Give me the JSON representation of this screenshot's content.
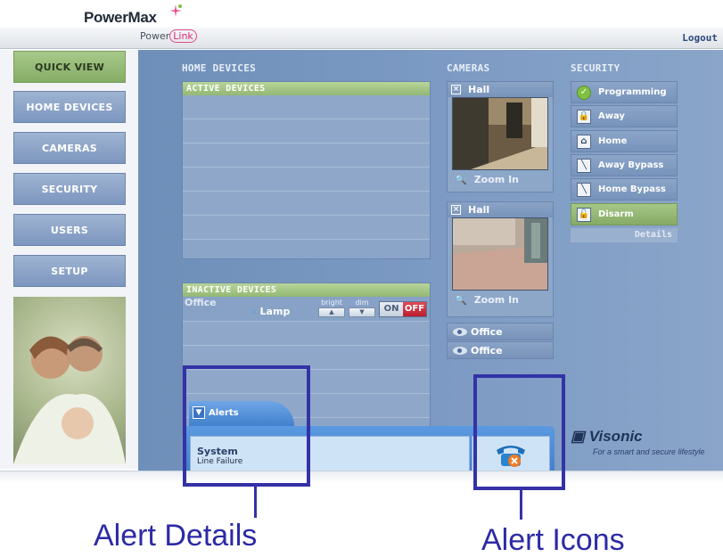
{
  "header": {
    "brand": "PowerMax",
    "sub_brand_prefix": "Power",
    "sub_brand_link": "Link",
    "logout": "Logout"
  },
  "sidebar": {
    "items": [
      {
        "label": "QUICK VIEW",
        "active": true
      },
      {
        "label": "HOME DEVICES",
        "active": false
      },
      {
        "label": "CAMERAS",
        "active": false
      },
      {
        "label": "SECURITY",
        "active": false
      },
      {
        "label": "USERS",
        "active": false
      },
      {
        "label": "SETUP",
        "active": false
      }
    ]
  },
  "home_devices": {
    "title": "HOME DEVICES",
    "active_header": "ACTIVE DEVICES",
    "inactive_header": "INACTIVE DEVICES",
    "inactive": {
      "room": "Office",
      "device": "Lamp",
      "bright_label": "bright",
      "dim_label": "dim",
      "on_label": "ON",
      "off_label": "OFF"
    }
  },
  "cameras": {
    "title": "CAMERAS",
    "feeds": [
      {
        "name": "Hall",
        "zoom_label": "Zoom In"
      },
      {
        "name": "Hall",
        "zoom_label": "Zoom In"
      }
    ],
    "collapsed": [
      "Office",
      "Office"
    ]
  },
  "security": {
    "title": "SECURITY",
    "items": [
      {
        "label": "Programming",
        "icon": "check-icon",
        "green": false
      },
      {
        "label": "Away",
        "icon": "lock-icon",
        "green": false
      },
      {
        "label": "Home",
        "icon": "home-icon",
        "green": false
      },
      {
        "label": "Away Bypass",
        "icon": "bypass-icon",
        "green": false
      },
      {
        "label": "Home Bypass",
        "icon": "bypass-icon",
        "green": false
      },
      {
        "label": "Disarm",
        "icon": "unlock-icon",
        "green": true
      }
    ],
    "details": "Details"
  },
  "logo": {
    "name": "Visonic",
    "tagline": "For a smart and secure lifestyle"
  },
  "alerts": {
    "tab_label": "Alerts",
    "title": "System",
    "message": "Line Failure",
    "icon": "phone-alert-icon"
  },
  "annotations": {
    "alert_details": "Alert Details",
    "alert_icons": "Alert Icons",
    "color": "#3432a6"
  },
  "colors": {
    "accent_green": "#93b873",
    "panel_blue": "#7d9bc4",
    "alert_blue": "#3e7cc8",
    "off_red": "#b91f2d"
  }
}
